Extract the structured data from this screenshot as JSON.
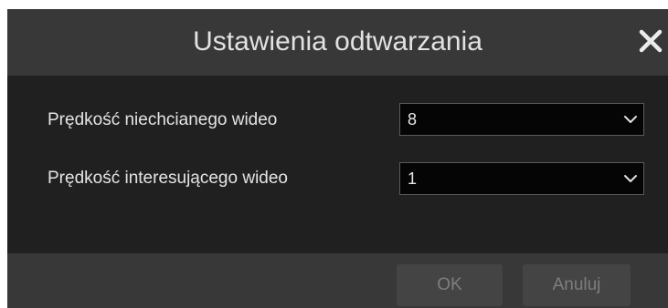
{
  "dialog": {
    "title": "Ustawienia odtwarzania",
    "close_icon": "close-icon"
  },
  "settings": [
    {
      "label": "Prędkość niechcianego wideo",
      "value": "8"
    },
    {
      "label": "Prędkość interesującego wideo",
      "value": "1"
    }
  ],
  "buttons": {
    "ok_label": "OK",
    "cancel_label": "Anuluj"
  },
  "colors": {
    "background": "#202020",
    "titlebar": "#383838",
    "select_bg": "#050505",
    "button_bg": "#444444",
    "button_text": "#7e7e7e"
  }
}
